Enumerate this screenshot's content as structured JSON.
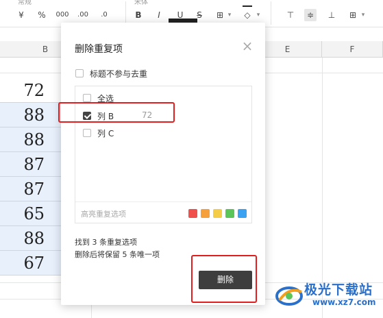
{
  "toolbar": {
    "top_label": "常规",
    "yen": "¥",
    "percent": "%",
    "thousands": "000",
    "inc_decimal": ".00",
    "dec_decimal": ".0",
    "font_label": "宋体",
    "bold": "B",
    "italic": "I",
    "underline": "U",
    "strike": "S",
    "border": "⊞",
    "fill": "◇",
    "dropdown": "▾",
    "align_top": "⊤",
    "align_middle": "≑",
    "align_bottom": "⊥",
    "merge": "⊞"
  },
  "sheet": {
    "columns": [
      "B",
      "E",
      "F"
    ],
    "cells": [
      "72",
      "88",
      "88",
      "87",
      "87",
      "65",
      "88",
      "67"
    ]
  },
  "dialog": {
    "title": "删除重复项",
    "close": "×",
    "header_option": "标题不参与去重",
    "select_all": "全选",
    "columns": [
      {
        "label": "列 B",
        "value": "72",
        "checked": true
      },
      {
        "label": "列 C",
        "value": "",
        "checked": false
      }
    ],
    "highlight_label": "高亮重复选项",
    "swatch_colors": [
      "#f0504c",
      "#f5a03a",
      "#f5cc45",
      "#5bc55a",
      "#3aa2f0"
    ],
    "found_text": "找到 3 条重复选项",
    "keep_text": "删除后将保留 5 条唯一项",
    "delete_button": "删除"
  },
  "watermark": {
    "title": "极光下载站",
    "url": "www.xz7.com"
  }
}
